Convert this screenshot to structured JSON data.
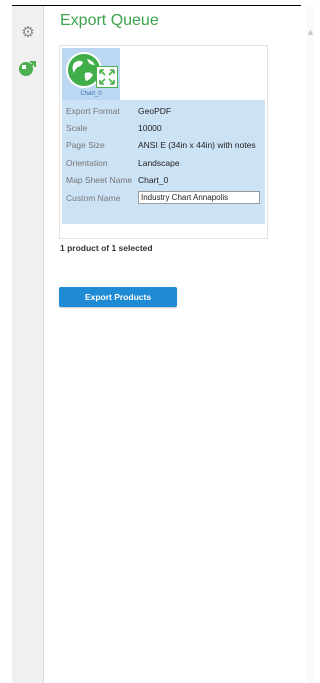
{
  "panel": {
    "title": "Export Queue"
  },
  "sidebar": {
    "items": [
      {
        "icon": "gear-icon",
        "label": ""
      },
      {
        "icon": "export-queue-icon",
        "label": ""
      }
    ]
  },
  "queue_items": [
    {
      "thumbnail_label": "Chart_0",
      "selected": true,
      "properties": [
        {
          "key": "Export Format",
          "value": "GeoPDF"
        },
        {
          "key": "Scale",
          "value": "10000"
        },
        {
          "key": "Page Size",
          "value": "ANSI E (34in x 44in) with notes"
        },
        {
          "key": "Orientation",
          "value": "Landscape"
        },
        {
          "key": "Map Sheet Name",
          "value": "Chart_0"
        },
        {
          "key": "Custom Name",
          "value": "Industry Chart Annapolis"
        }
      ]
    }
  ],
  "status": {
    "selection_text": "1 product of 1 selected"
  },
  "actions": {
    "export_label": "Export Products"
  },
  "colors": {
    "title": "#3ba34a",
    "accent_green": "#4caf50",
    "selection_bg": "#cce2f5",
    "button": "#1f8bd4"
  }
}
